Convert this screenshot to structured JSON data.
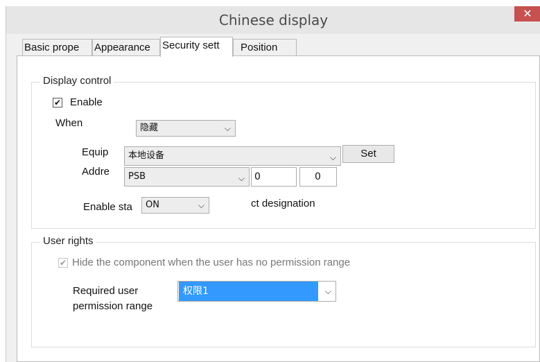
{
  "window": {
    "title": "Chinese display",
    "close_glyph": "✕"
  },
  "tabs": [
    {
      "label": "Basic prope"
    },
    {
      "label": "Appearance"
    },
    {
      "label": "Security sett"
    },
    {
      "label": "Position"
    }
  ],
  "display_control": {
    "legend": "Display control",
    "enable_label": "Enable",
    "enable_checked": true,
    "when_label": "When",
    "when_value": "隐藏",
    "equip_label": "Equip",
    "equip_value": "本地设备",
    "set_button": "Set",
    "addre_label": "Addre",
    "addre_type": "PSB",
    "addre_value1": "0",
    "addre_value2": "0",
    "enable_state_label": "Enable sta",
    "enable_state_value": "ON",
    "designation_text": "ct designation"
  },
  "user_rights": {
    "legend": "User rights",
    "hide_label": "Hide the component when the user has no permission range",
    "hide_checked": true,
    "required_label_line1": "Required user",
    "required_label_line2": "permission range",
    "permission_value": "权限1"
  },
  "icons": {
    "chevron": "chevron-down-icon",
    "check": "check-icon",
    "close": "close-icon"
  }
}
